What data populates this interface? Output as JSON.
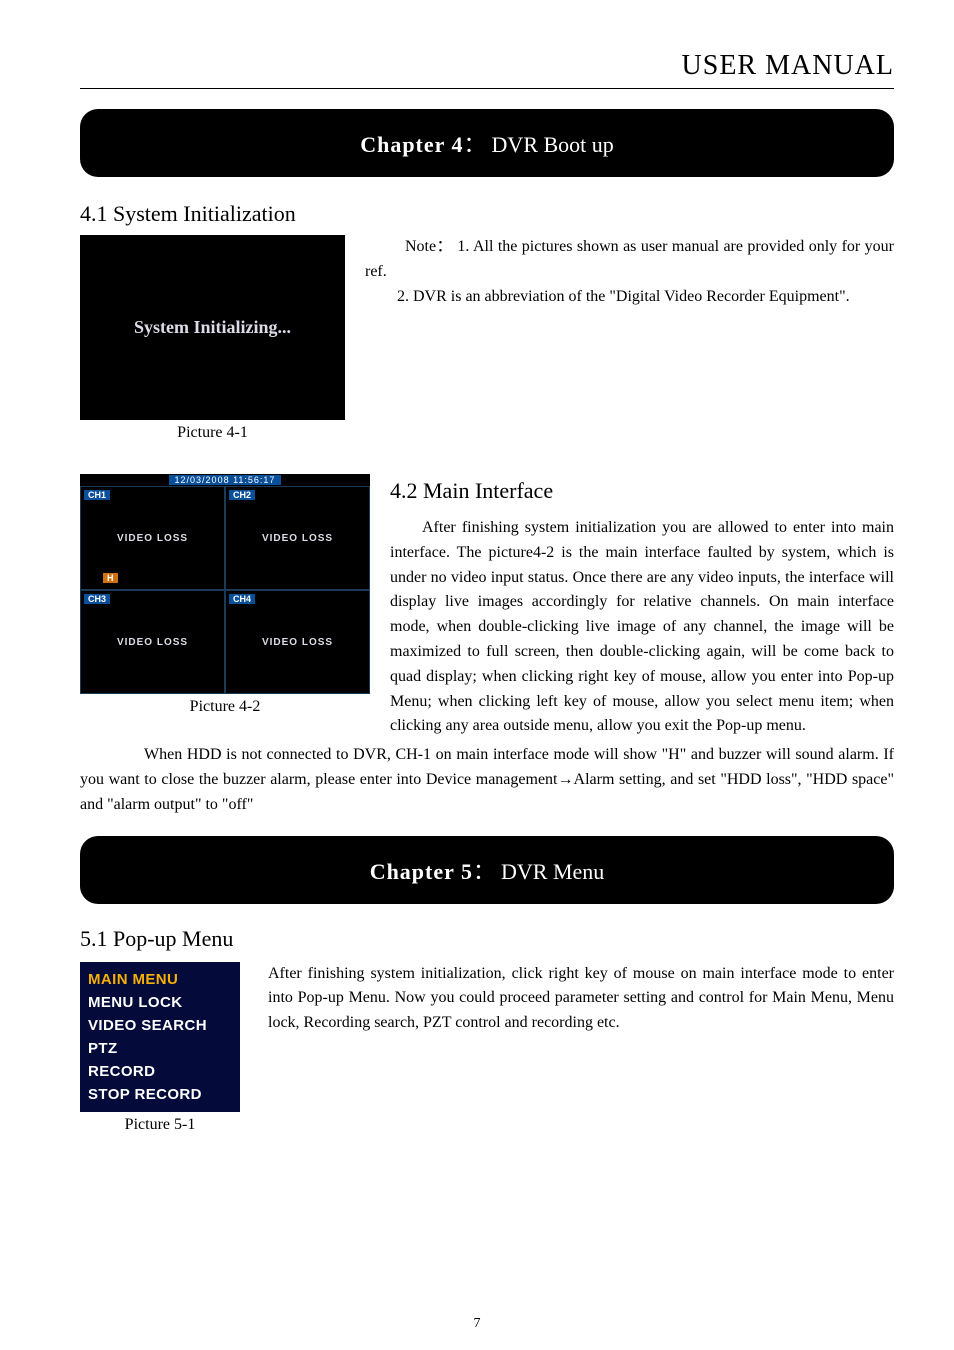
{
  "header": {
    "title": "USER MANUAL"
  },
  "chapter4": {
    "bar": {
      "no": "Chapter 4",
      "sep": "：",
      "title": "DVR Boot up"
    },
    "section_4_1": {
      "title": "4.1 System Initialization"
    },
    "fig_4_1": {
      "screen_text": "System Initializing...",
      "caption": "Picture 4-1"
    },
    "note": {
      "label": "Note",
      "sep": "：",
      "line1": " 1. All the pictures shown as user manual are provided only for your ref.",
      "line2": "2. DVR is an abbreviation of the \"Digital Video Recorder Equipment\"."
    },
    "section_4_2": {
      "title": "4.2 Main Interface"
    },
    "fig_4_2": {
      "timestamp": "12/03/2008  11:56:17",
      "channels": [
        "CH1",
        "CH2",
        "CH3",
        "CH4"
      ],
      "video_loss": "VIDEO LOSS",
      "h_badge": "H",
      "caption": "Picture 4-2"
    },
    "para_4_2": "After finishing system initialization you are allowed to enter into main interface. The picture4-2 is the main interface faulted by system, which is under no video input status. Once there are any video inputs, the interface will display live images accordingly for relative channels. On main interface mode, when double-clicking live image of any channel, the image will be maximized to full screen, then double-clicking again, will be come back to quad display; when clicking right key of mouse, allow you enter into Pop-up Menu; when clicking left key of mouse, allow you select menu item; when clicking any area outside menu, allow you exit the Pop-up menu.",
    "tail": {
      "before_arrow": "When HDD is not connected to DVR, CH-1 on main interface mode will show \"H\" and buzzer will sound alarm. If you want to close the buzzer alarm, please enter into Device management",
      "arrow": "→",
      "after_arrow": "Alarm setting, and set \"HDD loss\", \"HDD space\" and \"alarm output\" to \"off\""
    }
  },
  "chapter5": {
    "bar": {
      "no": "Chapter 5",
      "sep": "：",
      "title": "DVR Menu"
    },
    "section_5_1": {
      "title": "5.1 Pop-up Menu"
    },
    "fig_5_1": {
      "items": [
        {
          "label": "MAIN MENU",
          "highlight": true
        },
        {
          "label": "MENU LOCK",
          "highlight": false
        },
        {
          "label": "VIDEO SEARCH",
          "highlight": false
        },
        {
          "label": "PTZ",
          "highlight": false
        },
        {
          "label": "RECORD",
          "highlight": false
        },
        {
          "label": "STOP RECORD",
          "highlight": false
        }
      ],
      "caption": "Picture 5-1"
    },
    "para_5_1": "After finishing system initialization, click right key of mouse on main interface mode to enter into Pop-up Menu. Now you could proceed parameter setting and control for Main Menu, Menu lock, Recording search, PZT control and recording etc."
  },
  "page_number": "7"
}
